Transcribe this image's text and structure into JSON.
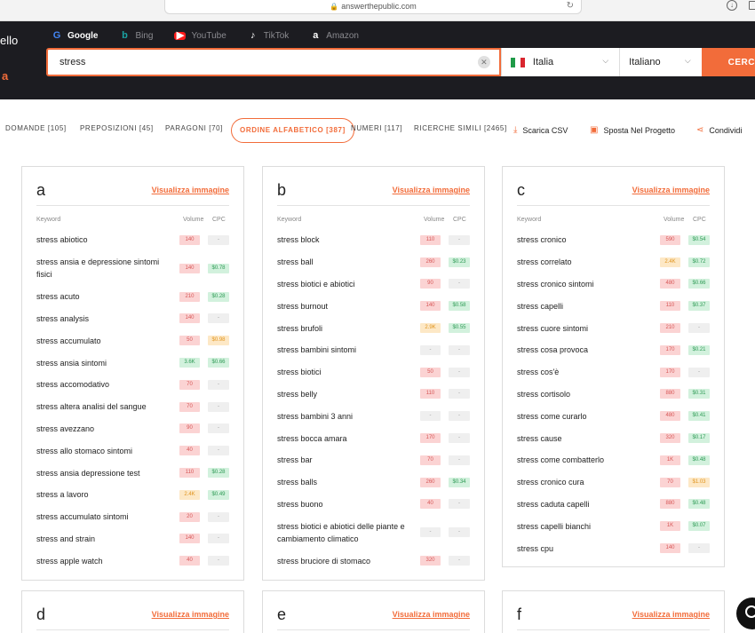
{
  "browser": {
    "url": "answerthepublic.com"
  },
  "header": {
    "brand_partial": "ello",
    "brand_accent": "a",
    "engines": [
      {
        "label": "Google",
        "icon": "google-icon",
        "glyph": "G",
        "active": true
      },
      {
        "label": "Bing",
        "icon": "bing-icon",
        "glyph": "b",
        "active": false
      },
      {
        "label": "YouTube",
        "icon": "youtube-icon",
        "glyph": "▶",
        "active": false
      },
      {
        "label": "TikTok",
        "icon": "tiktok-icon",
        "glyph": "♪",
        "active": false
      },
      {
        "label": "Amazon",
        "icon": "amazon-icon",
        "glyph": "a",
        "active": false
      }
    ],
    "search": {
      "value": "stress",
      "placeholder": ""
    },
    "country": "Italia",
    "language": "Italiano",
    "search_button": "CERC"
  },
  "tabs": [
    {
      "label": "DOMANDE [105]",
      "active": false
    },
    {
      "label": "PREPOSIZIONI [45]",
      "active": false
    },
    {
      "label": "PARAGONI [70]",
      "active": false
    },
    {
      "label": "ORDINE ALFABETICO [387]",
      "active": true
    },
    {
      "label": "NUMERI [117]",
      "active": false
    },
    {
      "label": "RICERCHE SIMILI [2465]",
      "active": false
    }
  ],
  "actions": [
    {
      "label": "Scarica CSV",
      "icon": "download-icon",
      "glyph": "⤓"
    },
    {
      "label": "Sposta Nel Progetto",
      "icon": "folder-icon",
      "glyph": "▣"
    },
    {
      "label": "Condividi",
      "icon": "share-icon",
      "glyph": "⋖"
    }
  ],
  "column_labels": {
    "keyword": "Keyword",
    "volume": "Volume",
    "cpc": "CPC"
  },
  "view_image_label": "Visualizza immagine",
  "colors": {
    "accent": "#f26c3a",
    "header_bg": "#1c1c21"
  },
  "cards": [
    {
      "letter": "a",
      "rows": [
        {
          "keyword": "stress abiotico",
          "volume": "140",
          "vol_level": "red",
          "cpc": "-",
          "cpc_level": "gray"
        },
        {
          "keyword": "stress ansia e depressione sintomi fisici",
          "volume": "140",
          "vol_level": "red",
          "cpc": "$0.78",
          "cpc_level": "green"
        },
        {
          "keyword": "stress acuto",
          "volume": "210",
          "vol_level": "red",
          "cpc": "$0.28",
          "cpc_level": "green"
        },
        {
          "keyword": "stress analysis",
          "volume": "140",
          "vol_level": "red",
          "cpc": "-",
          "cpc_level": "gray"
        },
        {
          "keyword": "stress accumulato",
          "volume": "50",
          "vol_level": "red",
          "cpc": "$0.98",
          "cpc_level": "yellow"
        },
        {
          "keyword": "stress ansia sintomi",
          "volume": "3.6K",
          "vol_level": "green",
          "cpc": "$0.66",
          "cpc_level": "green"
        },
        {
          "keyword": "stress accomodativo",
          "volume": "70",
          "vol_level": "red",
          "cpc": "-",
          "cpc_level": "gray"
        },
        {
          "keyword": "stress altera analisi del sangue",
          "volume": "70",
          "vol_level": "red",
          "cpc": "-",
          "cpc_level": "gray"
        },
        {
          "keyword": "stress avezzano",
          "volume": "90",
          "vol_level": "red",
          "cpc": "-",
          "cpc_level": "gray"
        },
        {
          "keyword": "stress allo stomaco sintomi",
          "volume": "40",
          "vol_level": "red",
          "cpc": "-",
          "cpc_level": "gray"
        },
        {
          "keyword": "stress ansia depressione test",
          "volume": "110",
          "vol_level": "red",
          "cpc": "$0.28",
          "cpc_level": "green"
        },
        {
          "keyword": "stress a lavoro",
          "volume": "2.4K",
          "vol_level": "yellow",
          "cpc": "$0.49",
          "cpc_level": "green"
        },
        {
          "keyword": "stress accumulato sintomi",
          "volume": "20",
          "vol_level": "red",
          "cpc": "-",
          "cpc_level": "gray"
        },
        {
          "keyword": "stress and strain",
          "volume": "140",
          "vol_level": "red",
          "cpc": "-",
          "cpc_level": "gray"
        },
        {
          "keyword": "stress apple watch",
          "volume": "40",
          "vol_level": "red",
          "cpc": "-",
          "cpc_level": "gray"
        }
      ]
    },
    {
      "letter": "b",
      "rows": [
        {
          "keyword": "stress block",
          "volume": "110",
          "vol_level": "red",
          "cpc": "-",
          "cpc_level": "gray"
        },
        {
          "keyword": "stress ball",
          "volume": "260",
          "vol_level": "red",
          "cpc": "$0.23",
          "cpc_level": "green"
        },
        {
          "keyword": "stress biotici e abiotici",
          "volume": "90",
          "vol_level": "red",
          "cpc": "-",
          "cpc_level": "gray"
        },
        {
          "keyword": "stress burnout",
          "volume": "140",
          "vol_level": "red",
          "cpc": "$0.58",
          "cpc_level": "green"
        },
        {
          "keyword": "stress brufoli",
          "volume": "2.9K",
          "vol_level": "yellow",
          "cpc": "$0.55",
          "cpc_level": "green"
        },
        {
          "keyword": "stress bambini sintomi",
          "volume": "-",
          "vol_level": "gray",
          "cpc": "-",
          "cpc_level": "gray"
        },
        {
          "keyword": "stress biotici",
          "volume": "50",
          "vol_level": "red",
          "cpc": "-",
          "cpc_level": "gray"
        },
        {
          "keyword": "stress belly",
          "volume": "110",
          "vol_level": "red",
          "cpc": "-",
          "cpc_level": "gray"
        },
        {
          "keyword": "stress bambini 3 anni",
          "volume": "-",
          "vol_level": "gray",
          "cpc": "-",
          "cpc_level": "gray"
        },
        {
          "keyword": "stress bocca amara",
          "volume": "170",
          "vol_level": "red",
          "cpc": "-",
          "cpc_level": "gray"
        },
        {
          "keyword": "stress bar",
          "volume": "70",
          "vol_level": "red",
          "cpc": "-",
          "cpc_level": "gray"
        },
        {
          "keyword": "stress balls",
          "volume": "260",
          "vol_level": "red",
          "cpc": "$0.34",
          "cpc_level": "green"
        },
        {
          "keyword": "stress buono",
          "volume": "40",
          "vol_level": "red",
          "cpc": "-",
          "cpc_level": "gray"
        },
        {
          "keyword": "stress biotici e abiotici delle piante e cambiamento climatico",
          "volume": "-",
          "vol_level": "gray",
          "cpc": "-",
          "cpc_level": "gray"
        },
        {
          "keyword": "stress bruciore di stomaco",
          "volume": "320",
          "vol_level": "red",
          "cpc": "-",
          "cpc_level": "gray"
        }
      ]
    },
    {
      "letter": "c",
      "rows": [
        {
          "keyword": "stress cronico",
          "volume": "590",
          "vol_level": "red",
          "cpc": "$0.54",
          "cpc_level": "green"
        },
        {
          "keyword": "stress correlato",
          "volume": "2.4K",
          "vol_level": "yellow",
          "cpc": "$0.72",
          "cpc_level": "green"
        },
        {
          "keyword": "stress cronico sintomi",
          "volume": "480",
          "vol_level": "red",
          "cpc": "$0.66",
          "cpc_level": "green"
        },
        {
          "keyword": "stress capelli",
          "volume": "110",
          "vol_level": "red",
          "cpc": "$0.37",
          "cpc_level": "green"
        },
        {
          "keyword": "stress cuore sintomi",
          "volume": "210",
          "vol_level": "red",
          "cpc": "-",
          "cpc_level": "gray"
        },
        {
          "keyword": "stress cosa provoca",
          "volume": "170",
          "vol_level": "red",
          "cpc": "$0.21",
          "cpc_level": "green"
        },
        {
          "keyword": "stress cos'è",
          "volume": "170",
          "vol_level": "red",
          "cpc": "-",
          "cpc_level": "gray"
        },
        {
          "keyword": "stress cortisolo",
          "volume": "880",
          "vol_level": "red",
          "cpc": "$0.31",
          "cpc_level": "green"
        },
        {
          "keyword": "stress come curarlo",
          "volume": "480",
          "vol_level": "red",
          "cpc": "$0.41",
          "cpc_level": "green"
        },
        {
          "keyword": "stress cause",
          "volume": "320",
          "vol_level": "red",
          "cpc": "$0.17",
          "cpc_level": "green"
        },
        {
          "keyword": "stress come combatterlo",
          "volume": "1K",
          "vol_level": "red",
          "cpc": "$0.48",
          "cpc_level": "green"
        },
        {
          "keyword": "stress cronico cura",
          "volume": "70",
          "vol_level": "red",
          "cpc": "$1.03",
          "cpc_level": "yellow"
        },
        {
          "keyword": "stress caduta capelli",
          "volume": "880",
          "vol_level": "red",
          "cpc": "$0.48",
          "cpc_level": "green"
        },
        {
          "keyword": "stress capelli bianchi",
          "volume": "1K",
          "vol_level": "red",
          "cpc": "$0.07",
          "cpc_level": "green"
        },
        {
          "keyword": "stress cpu",
          "volume": "140",
          "vol_level": "red",
          "cpc": "-",
          "cpc_level": "gray"
        }
      ]
    },
    {
      "letter": "d",
      "rows": []
    },
    {
      "letter": "e",
      "rows": []
    },
    {
      "letter": "f",
      "rows": []
    }
  ]
}
